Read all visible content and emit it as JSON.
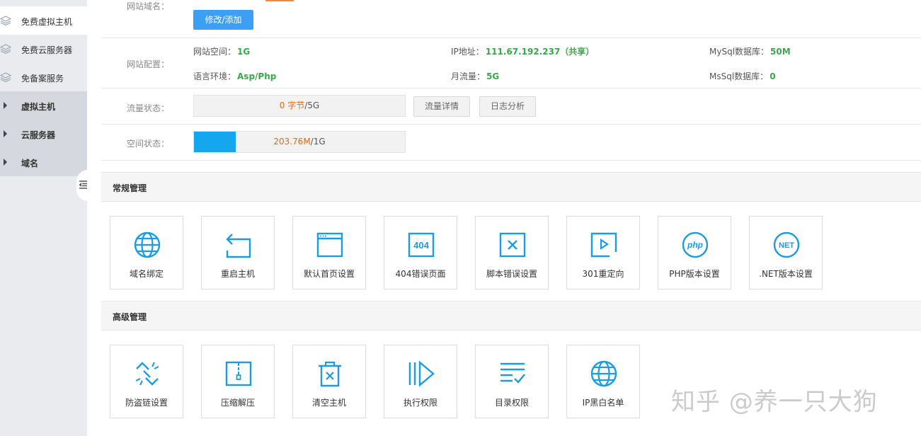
{
  "sidebar": {
    "items": [
      {
        "label": "免费虚拟主机",
        "icon": "layers-icon"
      },
      {
        "label": "免费云服务器",
        "icon": "layers-icon"
      },
      {
        "label": "免备案服务",
        "icon": "layers-icon"
      }
    ],
    "groups": [
      {
        "label": "虚拟主机"
      },
      {
        "label": "云服务器"
      },
      {
        "label": "域名"
      }
    ]
  },
  "site": {
    "domain_label": "网站域名：",
    "edit_button": "修改/添加",
    "config_label": "网站配置：",
    "config": [
      {
        "key": "网站空间：",
        "value": "1G"
      },
      {
        "key": "IP地址：",
        "value": "111.67.192.237（共享）"
      },
      {
        "key": "MySql数据库：",
        "value": "50M"
      },
      {
        "key": "语言环境：",
        "value": "Asp/Php"
      },
      {
        "key": "月流量：",
        "value": "5G"
      },
      {
        "key": "MsSql数据库：",
        "value": "0"
      }
    ],
    "traffic": {
      "label": "流量状态：",
      "used": "0 字节",
      "total": "/5G",
      "fraction": 0,
      "detail_button": "流量详情",
      "log_button": "日志分析"
    },
    "space": {
      "label": "空间状态：",
      "used": "203.76M",
      "total": "/1G",
      "fraction": 0.199
    }
  },
  "general": {
    "title": "常规管理",
    "tiles": [
      {
        "label": "域名绑定",
        "icon": "globe-icon"
      },
      {
        "label": "重启主机",
        "icon": "restart-icon"
      },
      {
        "label": "默认首页设置",
        "icon": "browser-window-icon"
      },
      {
        "label": "404错误页面",
        "icon": "error-404-icon"
      },
      {
        "label": "脚本错误设置",
        "icon": "close-box-icon"
      },
      {
        "label": "301重定向",
        "icon": "redirect-icon"
      },
      {
        "label": "PHP版本设置",
        "icon": "php-icon"
      },
      {
        "label": ".NET版本设置",
        "icon": "dotnet-icon"
      }
    ]
  },
  "advanced": {
    "title": "高级管理",
    "tiles": [
      {
        "label": "防盗链设置",
        "icon": "broken-link-icon"
      },
      {
        "label": "压缩解压",
        "icon": "zip-file-icon"
      },
      {
        "label": "清空主机",
        "icon": "trash-icon"
      },
      {
        "label": "执行权限",
        "icon": "execute-icon"
      },
      {
        "label": "目录权限",
        "icon": "directory-list-icon"
      },
      {
        "label": "IP黑白名单",
        "icon": "globe-icon"
      }
    ]
  },
  "watermark": "知乎 @养一只大狗",
  "colors": {
    "accent": "#3d9ff3",
    "icon": "#1a9be2",
    "value_green": "#3aa84a",
    "used_orange": "#e36b18",
    "bar_fill": "#14a6ef"
  }
}
